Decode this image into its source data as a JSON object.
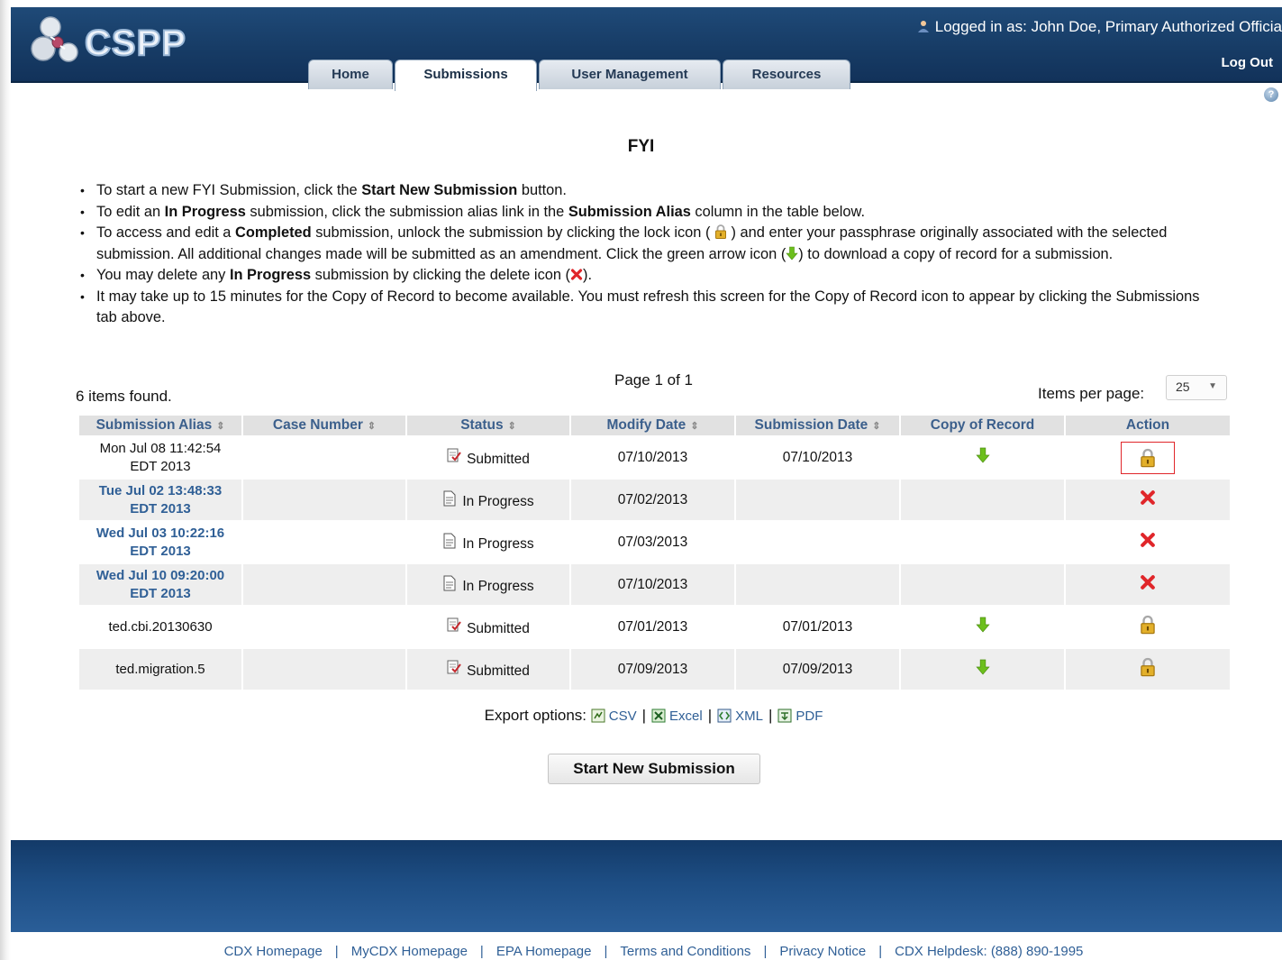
{
  "app": {
    "logo_text": "CSPP"
  },
  "nav": {
    "tabs": [
      {
        "label": "Home"
      },
      {
        "label": "Submissions"
      },
      {
        "label": "User Management"
      },
      {
        "label": "Resources"
      }
    ],
    "active_tab": "Submissions"
  },
  "user": {
    "logged_in_text": "Logged in as: John Doe, Primary Authorized Officia",
    "logout_label": "Log Out"
  },
  "page": {
    "title": "FYI"
  },
  "instructions": {
    "i1_a": "To start a new FYI Submission, click the ",
    "i1_b": "Start New Submission",
    "i1_c": " button.",
    "i2_a": "To edit an ",
    "i2_b": "In Progress",
    "i2_c": " submission, click the submission alias link in the ",
    "i2_d": "Submission Alias",
    "i2_e": " column in the table below.",
    "i3_a": "To access and edit a ",
    "i3_b": "Completed",
    "i3_c": " submission, unlock the submission by clicking the lock icon ( ",
    "i3_d": " ) and enter your passphrase originally associated with the selected submission. All additional changes made will be submitted as an amendment. Click the green arrow icon (",
    "i3_e": ") to download a copy of record for a submission.",
    "i4_a": "You may delete any ",
    "i4_b": "In Progress",
    "i4_c": " submission by clicking the delete icon (",
    "i4_d": ").",
    "i5": "It may take up to 15 minutes for the Copy of Record to become available. You must refresh this screen for the Copy of Record icon to appear by clicking the Submissions tab above."
  },
  "table_meta": {
    "page_info": "Page 1 of 1",
    "items_found": "6 items found.",
    "items_per_page_label": "Items per page:",
    "items_per_page_value": "25"
  },
  "table": {
    "headers": [
      "Submission Alias",
      "Case Number",
      "Status",
      "Modify Date",
      "Submission Date",
      "Copy of Record",
      "Action"
    ],
    "sort_glyph": "⇕",
    "rows": [
      {
        "alias_line1": "Mon Jul 08 11:42:54",
        "alias_line2": "EDT 2013",
        "case_number": "",
        "status": "Submitted",
        "modify_date": "07/10/2013",
        "submission_date": "07/10/2013"
      },
      {
        "alias_line1": "Tue Jul 02 13:48:33",
        "alias_line2": "EDT 2013",
        "case_number": "",
        "status": "In Progress",
        "modify_date": "07/02/2013",
        "submission_date": ""
      },
      {
        "alias_line1": "Wed Jul 03 10:22:16",
        "alias_line2": "EDT 2013",
        "case_number": "",
        "status": "In Progress",
        "modify_date": "07/03/2013",
        "submission_date": ""
      },
      {
        "alias_line1": "Wed Jul 10 09:20:00",
        "alias_line2": "EDT 2013",
        "case_number": "",
        "status": "In Progress",
        "modify_date": "07/10/2013",
        "submission_date": ""
      },
      {
        "alias_line1": "ted.cbi.20130630",
        "alias_line2": "",
        "case_number": "",
        "status": "Submitted",
        "modify_date": "07/01/2013",
        "submission_date": "07/01/2013"
      },
      {
        "alias_line1": "ted.migration.5",
        "alias_line2": "",
        "case_number": "",
        "status": "Submitted",
        "modify_date": "07/09/2013",
        "submission_date": "07/09/2013"
      }
    ]
  },
  "export": {
    "label": "Export options:",
    "csv": "CSV",
    "excel": "Excel",
    "xml": "XML",
    "pdf": "PDF",
    "sep": "|"
  },
  "actions": {
    "start_new_submission": "Start New Submission"
  },
  "footer": {
    "links": [
      "CDX Homepage",
      "MyCDX Homepage",
      "EPA Homepage",
      "Terms and Conditions",
      "Privacy Notice",
      "CDX Helpdesk: (888) 890-1995"
    ],
    "sep": "|"
  },
  "colors": {
    "header_bg": "#173c66",
    "link": "#2f5f96",
    "arrow_green": "#6cbf1c",
    "delete_red": "#e0262a",
    "lock_gold": "#d9a21a"
  }
}
